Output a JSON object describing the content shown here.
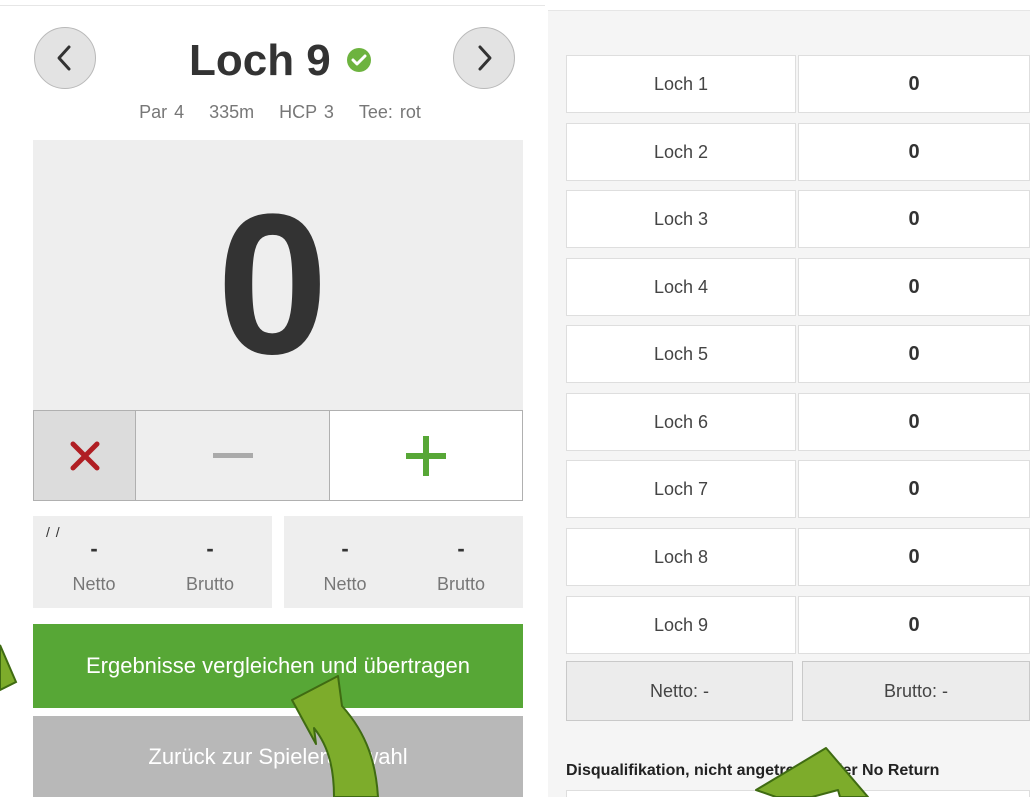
{
  "hole": {
    "title": "Loch 9",
    "par": "Par 4",
    "length": "335m",
    "hcp": "HCP 3",
    "tee": "Tee: rot"
  },
  "score": {
    "value": "0"
  },
  "controls": {
    "clear_icon": "x-icon",
    "minus_icon": "minus-icon",
    "plus_icon": "plus-icon"
  },
  "stats_left": {
    "mark": "/ /",
    "netto_value": "-",
    "netto_label": "Netto",
    "brutto_value": "-",
    "brutto_label": "Brutto"
  },
  "stats_right": {
    "netto_value": "-",
    "netto_label": "Netto",
    "brutto_value": "-",
    "brutto_label": "Brutto"
  },
  "buttons": {
    "compare": "Ergebnisse vergleichen und übertragen",
    "back": "Zurück zur Spielerauswahl"
  },
  "scorecard": {
    "rows": [
      {
        "hole": "Loch 1",
        "score": "0"
      },
      {
        "hole": "Loch 2",
        "score": "0"
      },
      {
        "hole": "Loch 3",
        "score": "0"
      },
      {
        "hole": "Loch 4",
        "score": "0"
      },
      {
        "hole": "Loch 5",
        "score": "0"
      },
      {
        "hole": "Loch 6",
        "score": "0"
      },
      {
        "hole": "Loch 7",
        "score": "0"
      },
      {
        "hole": "Loch 8",
        "score": "0"
      },
      {
        "hole": "Loch 9",
        "score": "0"
      }
    ],
    "netto": "Netto: -",
    "brutto": "Brutto: -",
    "dq_label": "Disqualifikation, nicht angetreten oder No Return"
  },
  "colors": {
    "accent_green": "#57a736",
    "clear_red": "#b01e23",
    "check_green": "#6db33f",
    "arrow_green": "#7dac2b"
  }
}
